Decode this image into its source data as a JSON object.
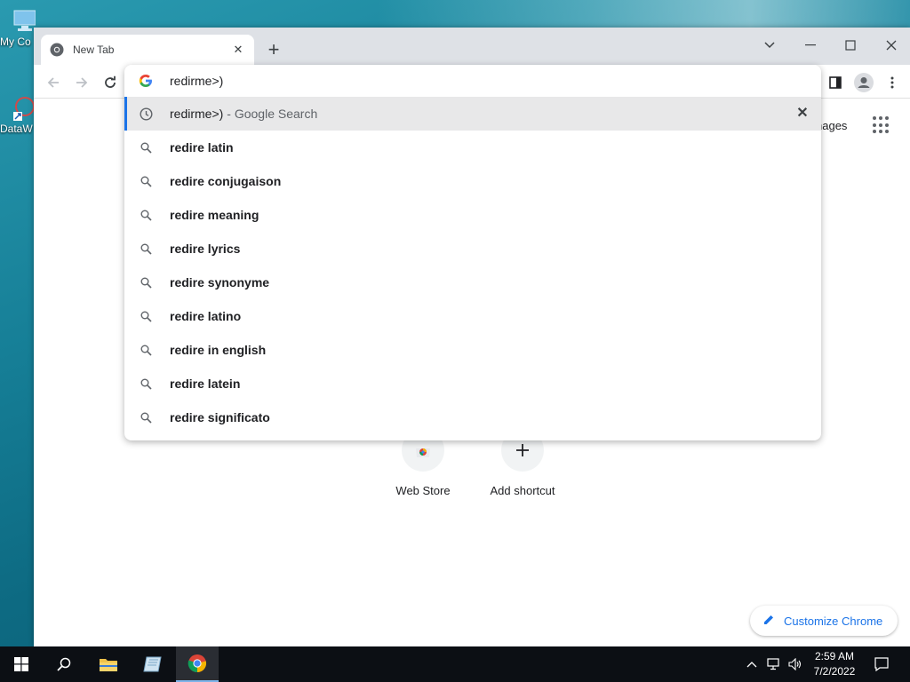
{
  "desktop": {
    "icons": [
      {
        "label": "My Co"
      },
      {
        "label": "DataW"
      }
    ]
  },
  "browser": {
    "tab_title": "New Tab",
    "omnibox_text": "redirme>)",
    "page": {
      "images_label": "nages",
      "shortcuts": [
        {
          "label": "Web Store"
        },
        {
          "label": "Add shortcut"
        }
      ],
      "customize_label": "Customize Chrome"
    },
    "suggestions": [
      {
        "icon": "history-icon",
        "text": "redirme>)",
        "desc": "- Google Search",
        "selected": true
      },
      {
        "icon": "search-icon",
        "text": "redire latin"
      },
      {
        "icon": "search-icon",
        "text": "redire conjugaison"
      },
      {
        "icon": "search-icon",
        "text": "redire meaning"
      },
      {
        "icon": "search-icon",
        "text": "redire lyrics"
      },
      {
        "icon": "search-icon",
        "text": "redire synonyme"
      },
      {
        "icon": "search-icon",
        "text": "redire latino"
      },
      {
        "icon": "search-icon",
        "text": "redire in english"
      },
      {
        "icon": "search-icon",
        "text": "redire latein"
      },
      {
        "icon": "search-icon",
        "text": "redire significato"
      }
    ]
  },
  "taskbar": {
    "time": "2:59 AM",
    "date": "7/2/2022"
  },
  "colors": {
    "accent": "#1a73e8",
    "taskbar": "#0c0f14"
  }
}
